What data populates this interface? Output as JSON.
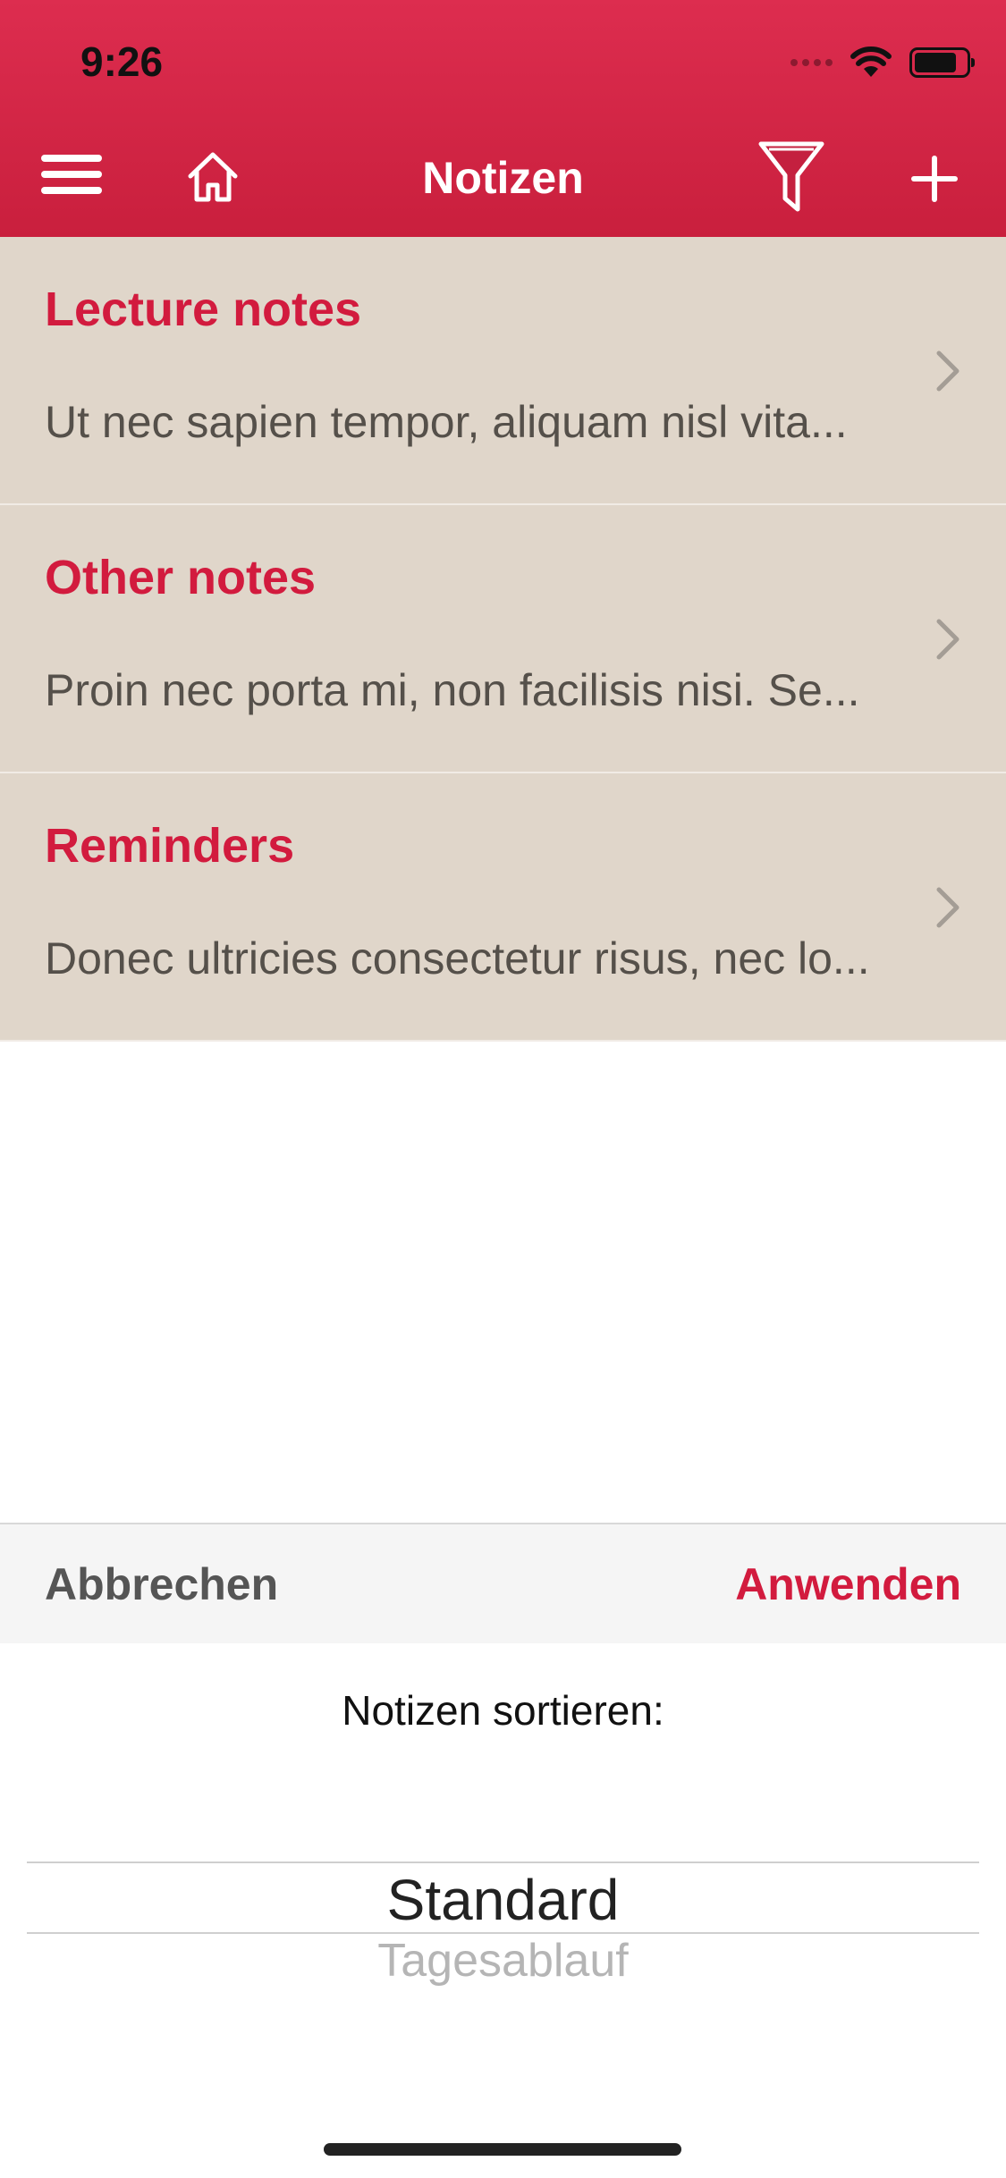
{
  "status_bar": {
    "time": "9:26"
  },
  "nav": {
    "title": "Notizen",
    "icons": {
      "menu": "hamburger-menu-icon",
      "home": "home-icon",
      "filter": "filter-icon",
      "add": "plus-icon"
    }
  },
  "notes": [
    {
      "title": "Lecture notes",
      "preview": "Ut nec sapien tempor, aliquam nisl vita..."
    },
    {
      "title": "Other notes",
      "preview": "Proin nec porta mi, non facilisis nisi. Se..."
    },
    {
      "title": "Reminders",
      "preview": "Donec ultricies consectetur risus, nec lo..."
    }
  ],
  "picker": {
    "cancel_label": "Abbrechen",
    "apply_label": "Anwenden",
    "label": "Notizen sortieren:",
    "selected_option": "Standard",
    "next_option": "Tagesablauf"
  },
  "colors": {
    "header": "#d4264a",
    "accent": "#d21b3e",
    "list_background": "#e0d6ca"
  }
}
